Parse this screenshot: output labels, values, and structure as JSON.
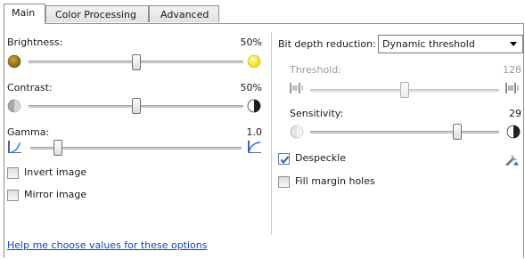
{
  "tabs": [
    {
      "label": "Main",
      "active": true
    },
    {
      "label": "Color Processing",
      "active": false
    },
    {
      "label": "Advanced",
      "active": false
    }
  ],
  "left": {
    "brightness": {
      "label": "Brightness:",
      "value": "50%",
      "level": 0.5
    },
    "contrast": {
      "label": "Contrast:",
      "value": "50%",
      "level": 0.5
    },
    "gamma": {
      "label": "Gamma:",
      "value": "1.0",
      "level": 0.13
    },
    "invert": {
      "label": "Invert image",
      "checked": false
    },
    "mirror": {
      "label": "Mirror image",
      "checked": false
    }
  },
  "right": {
    "bit_depth": {
      "label": "Bit depth reduction:",
      "selected": "Dynamic threshold"
    },
    "threshold": {
      "label": "Threshold:",
      "value": "128",
      "level": 0.5,
      "enabled": false
    },
    "sensitivity": {
      "label": "Sensitivity:",
      "value": "29",
      "level": 0.78
    },
    "despeckle": {
      "label": "Despeckle",
      "checked": true
    },
    "fill_margin": {
      "label": "Fill margin holes",
      "checked": false
    }
  },
  "help_link": "Help me choose values for these options",
  "colors": {
    "accent": "#0b44c8",
    "disabled_text": "#9b9b9b",
    "check_blue": "#2b58b5"
  },
  "icons": [
    "brightness-dark-icon",
    "brightness-light-icon",
    "contrast-low-icon",
    "contrast-high-icon",
    "gamma-low-icon",
    "gamma-high-icon",
    "threshold-low-icon",
    "threshold-high-icon",
    "sensitivity-low-icon",
    "sensitivity-high-icon",
    "wrench-settings-icon"
  ]
}
